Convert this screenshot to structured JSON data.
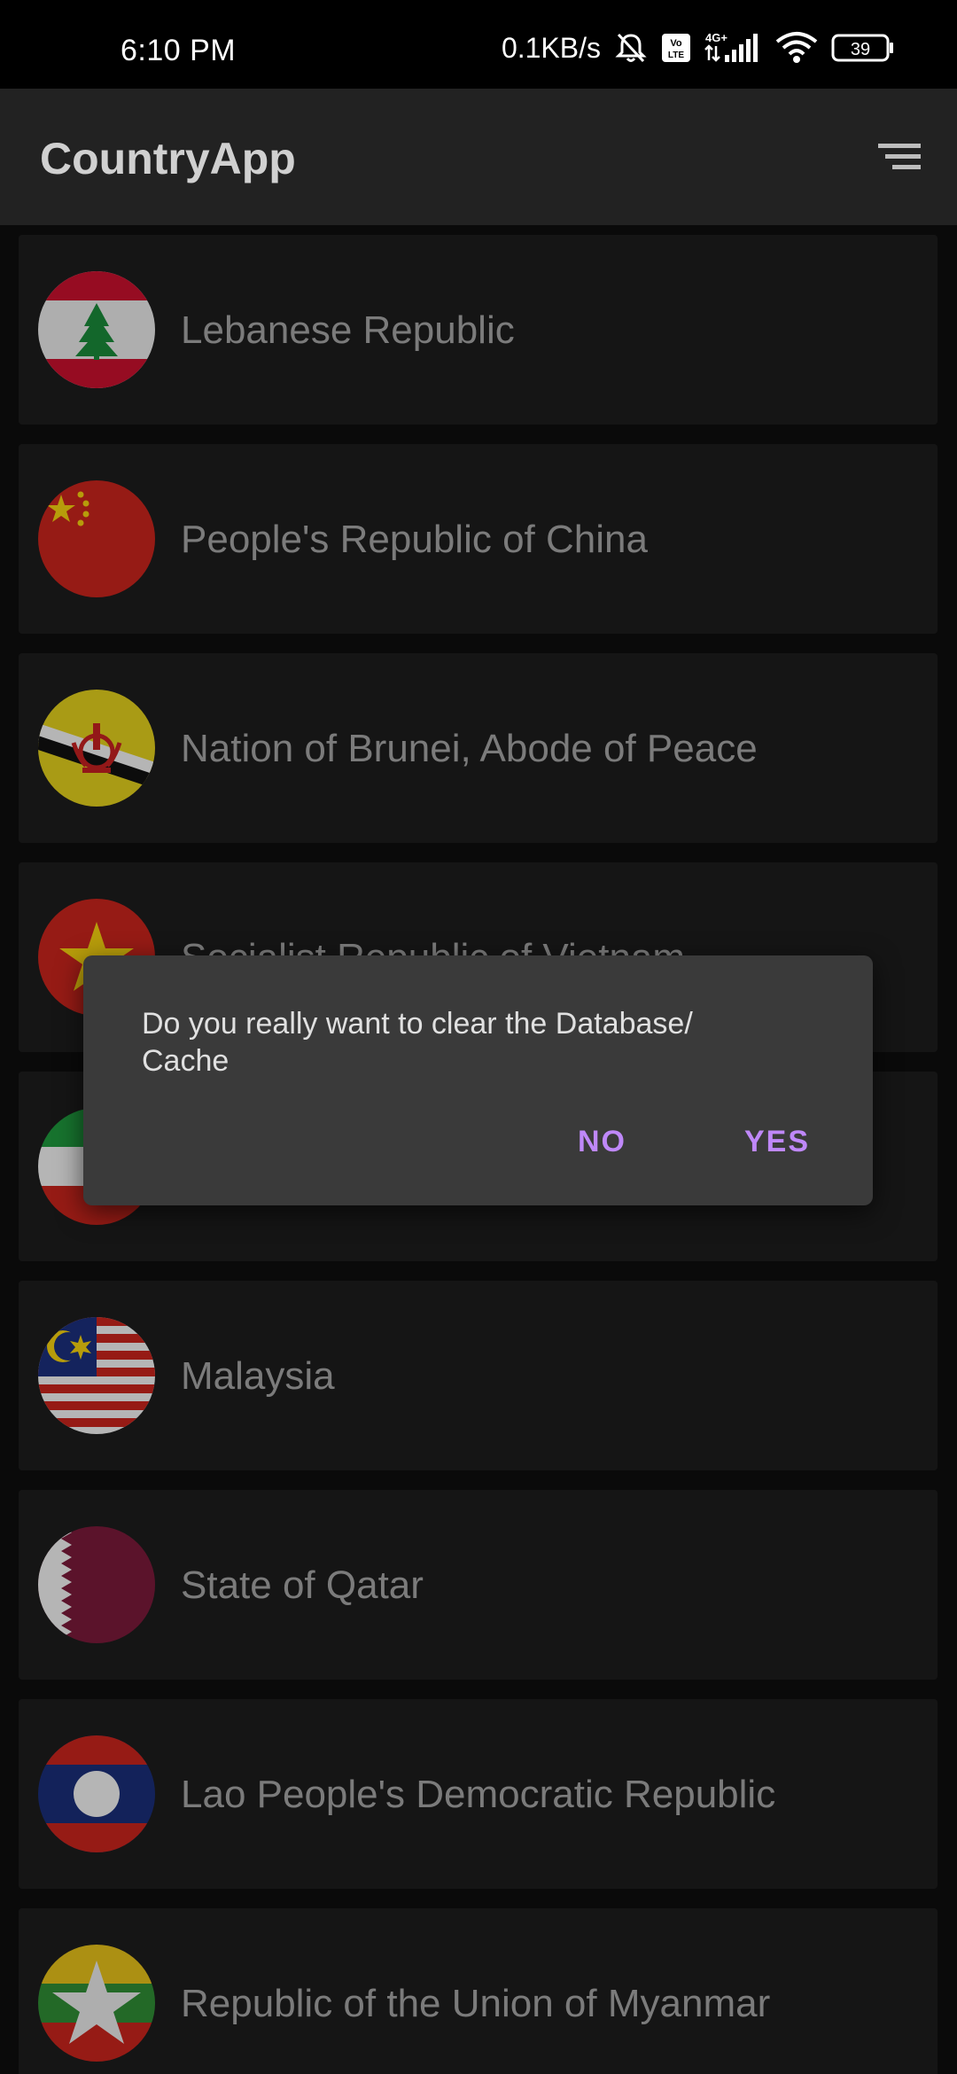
{
  "status_bar": {
    "time": "6:10 PM",
    "net_speed": "0.1KB/s",
    "network_type": "4G+",
    "volte": "Vo LTE",
    "battery": "39",
    "icons": [
      "mute-icon",
      "volte-icon",
      "signal-icon",
      "wifi-icon",
      "battery-icon"
    ]
  },
  "app_bar": {
    "title": "CountryApp",
    "menu_icon": "sort-menu-icon"
  },
  "countries": [
    {
      "name": "Lebanese Republic",
      "flag": "lebanon-flag-icon"
    },
    {
      "name": "People's Republic of China",
      "flag": "china-flag-icon"
    },
    {
      "name": "Nation of Brunei, Abode of Peace",
      "flag": "brunei-flag-icon"
    },
    {
      "name": "Socialist Republic of Vietnam",
      "flag": "vietnam-flag-icon"
    },
    {
      "name": "",
      "flag": "iran-flag-icon"
    },
    {
      "name": "Malaysia",
      "flag": "malaysia-flag-icon"
    },
    {
      "name": "State of Qatar",
      "flag": "qatar-flag-icon"
    },
    {
      "name": "Lao People's Democratic Republic",
      "flag": "laos-flag-icon"
    },
    {
      "name": "Republic of the Union of Myanmar",
      "flag": "myanmar-flag-icon"
    }
  ],
  "dialog": {
    "message": "Do you really want to clear the Database/ Cache",
    "no_label": "NO",
    "yes_label": "YES"
  },
  "colors": {
    "accent": "#bf88f9",
    "app_bar": "#222222",
    "row_bg": "#1d1d1d",
    "dialog_bg": "#3a3a3a"
  }
}
